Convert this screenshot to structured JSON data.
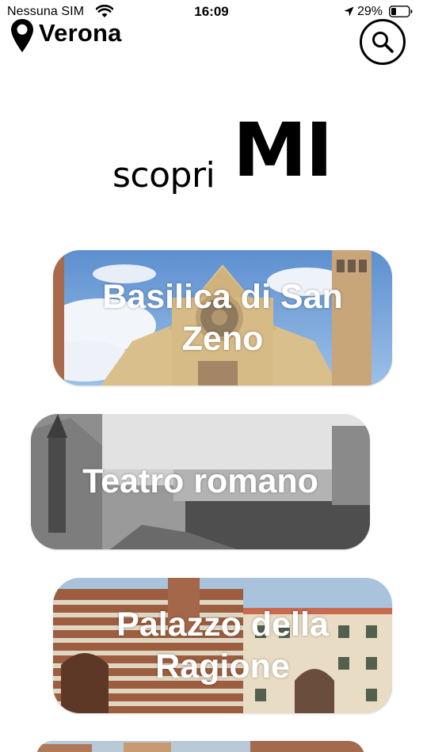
{
  "status_bar": {
    "carrier": "Nessuna SIM",
    "time": "16:09",
    "battery_percent": "29%",
    "battery_level": 0.29,
    "icons": [
      "wifi-icon",
      "location-arrow-icon",
      "battery-icon"
    ]
  },
  "header": {
    "city": "Verona",
    "icons": [
      "location-pin-icon",
      "search-icon"
    ]
  },
  "logo": {
    "prefix": "scopri",
    "suffix": "MI"
  },
  "places": [
    {
      "name": "Basilica di San Zeno"
    },
    {
      "name": "Teatro romano"
    },
    {
      "name": "Palazzo della Ragione"
    },
    {
      "name": ""
    }
  ],
  "colors": {
    "sky": "#6f9fd6",
    "stone": "#d8bf8e",
    "brick": "#9a5a3a",
    "text_on_image": "#ffffff"
  }
}
